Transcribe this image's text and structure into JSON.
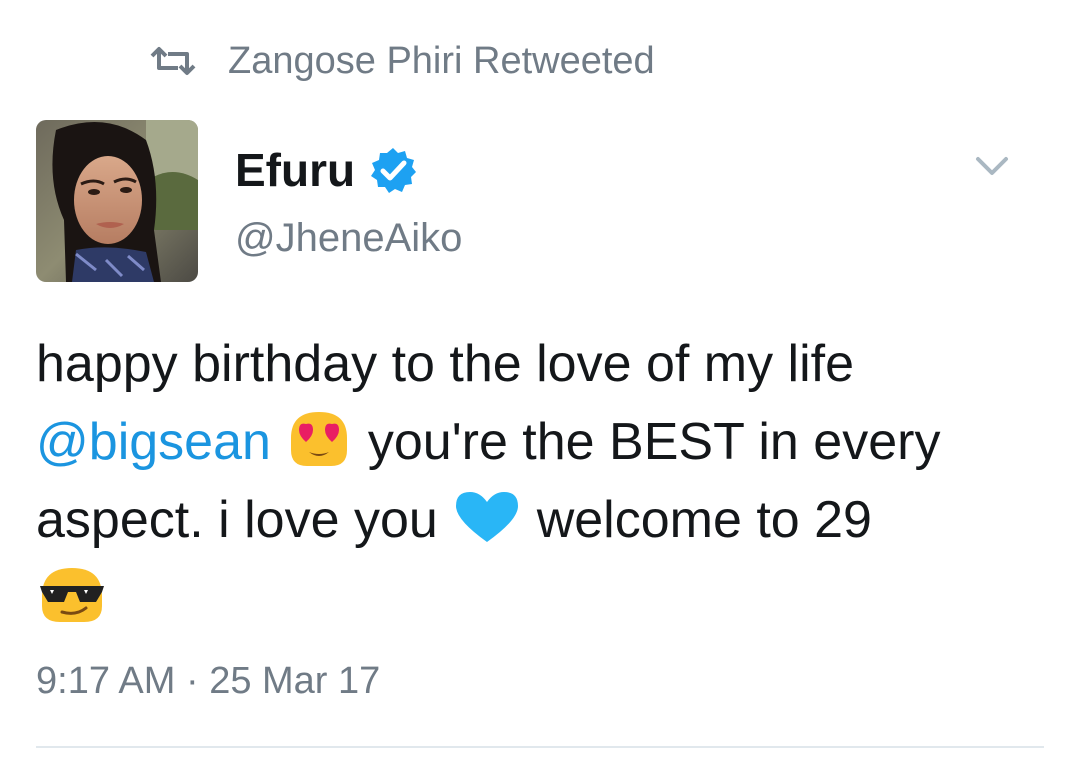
{
  "retweet": {
    "text": "Zangose Phiri Retweeted",
    "icon": "retweet-icon"
  },
  "author": {
    "display_name": "Efuru",
    "handle": "@JheneAiko",
    "verified_icon": "verified-badge-icon",
    "avatar_icon": "profile-photo"
  },
  "menu": {
    "icon": "chevron-down-icon"
  },
  "tweet": {
    "line1": "happy birthday to the love of my life",
    "mention": "@bigsean",
    "line2_rest": "you're the BEST in every",
    "line3_start": "aspect. i love you",
    "line3_end": "welcome to 29",
    "emojis": [
      "heart-eyes-emoji",
      "blue-heart-emoji",
      "sunglasses-emoji"
    ]
  },
  "meta": {
    "timestamp": "9:17 AM · 25 Mar 17"
  },
  "colors": {
    "text": "#14171a",
    "secondary": "#707b86",
    "link": "#1b95e0",
    "verified": "#1da1f2",
    "divider": "#e1e8ed"
  }
}
